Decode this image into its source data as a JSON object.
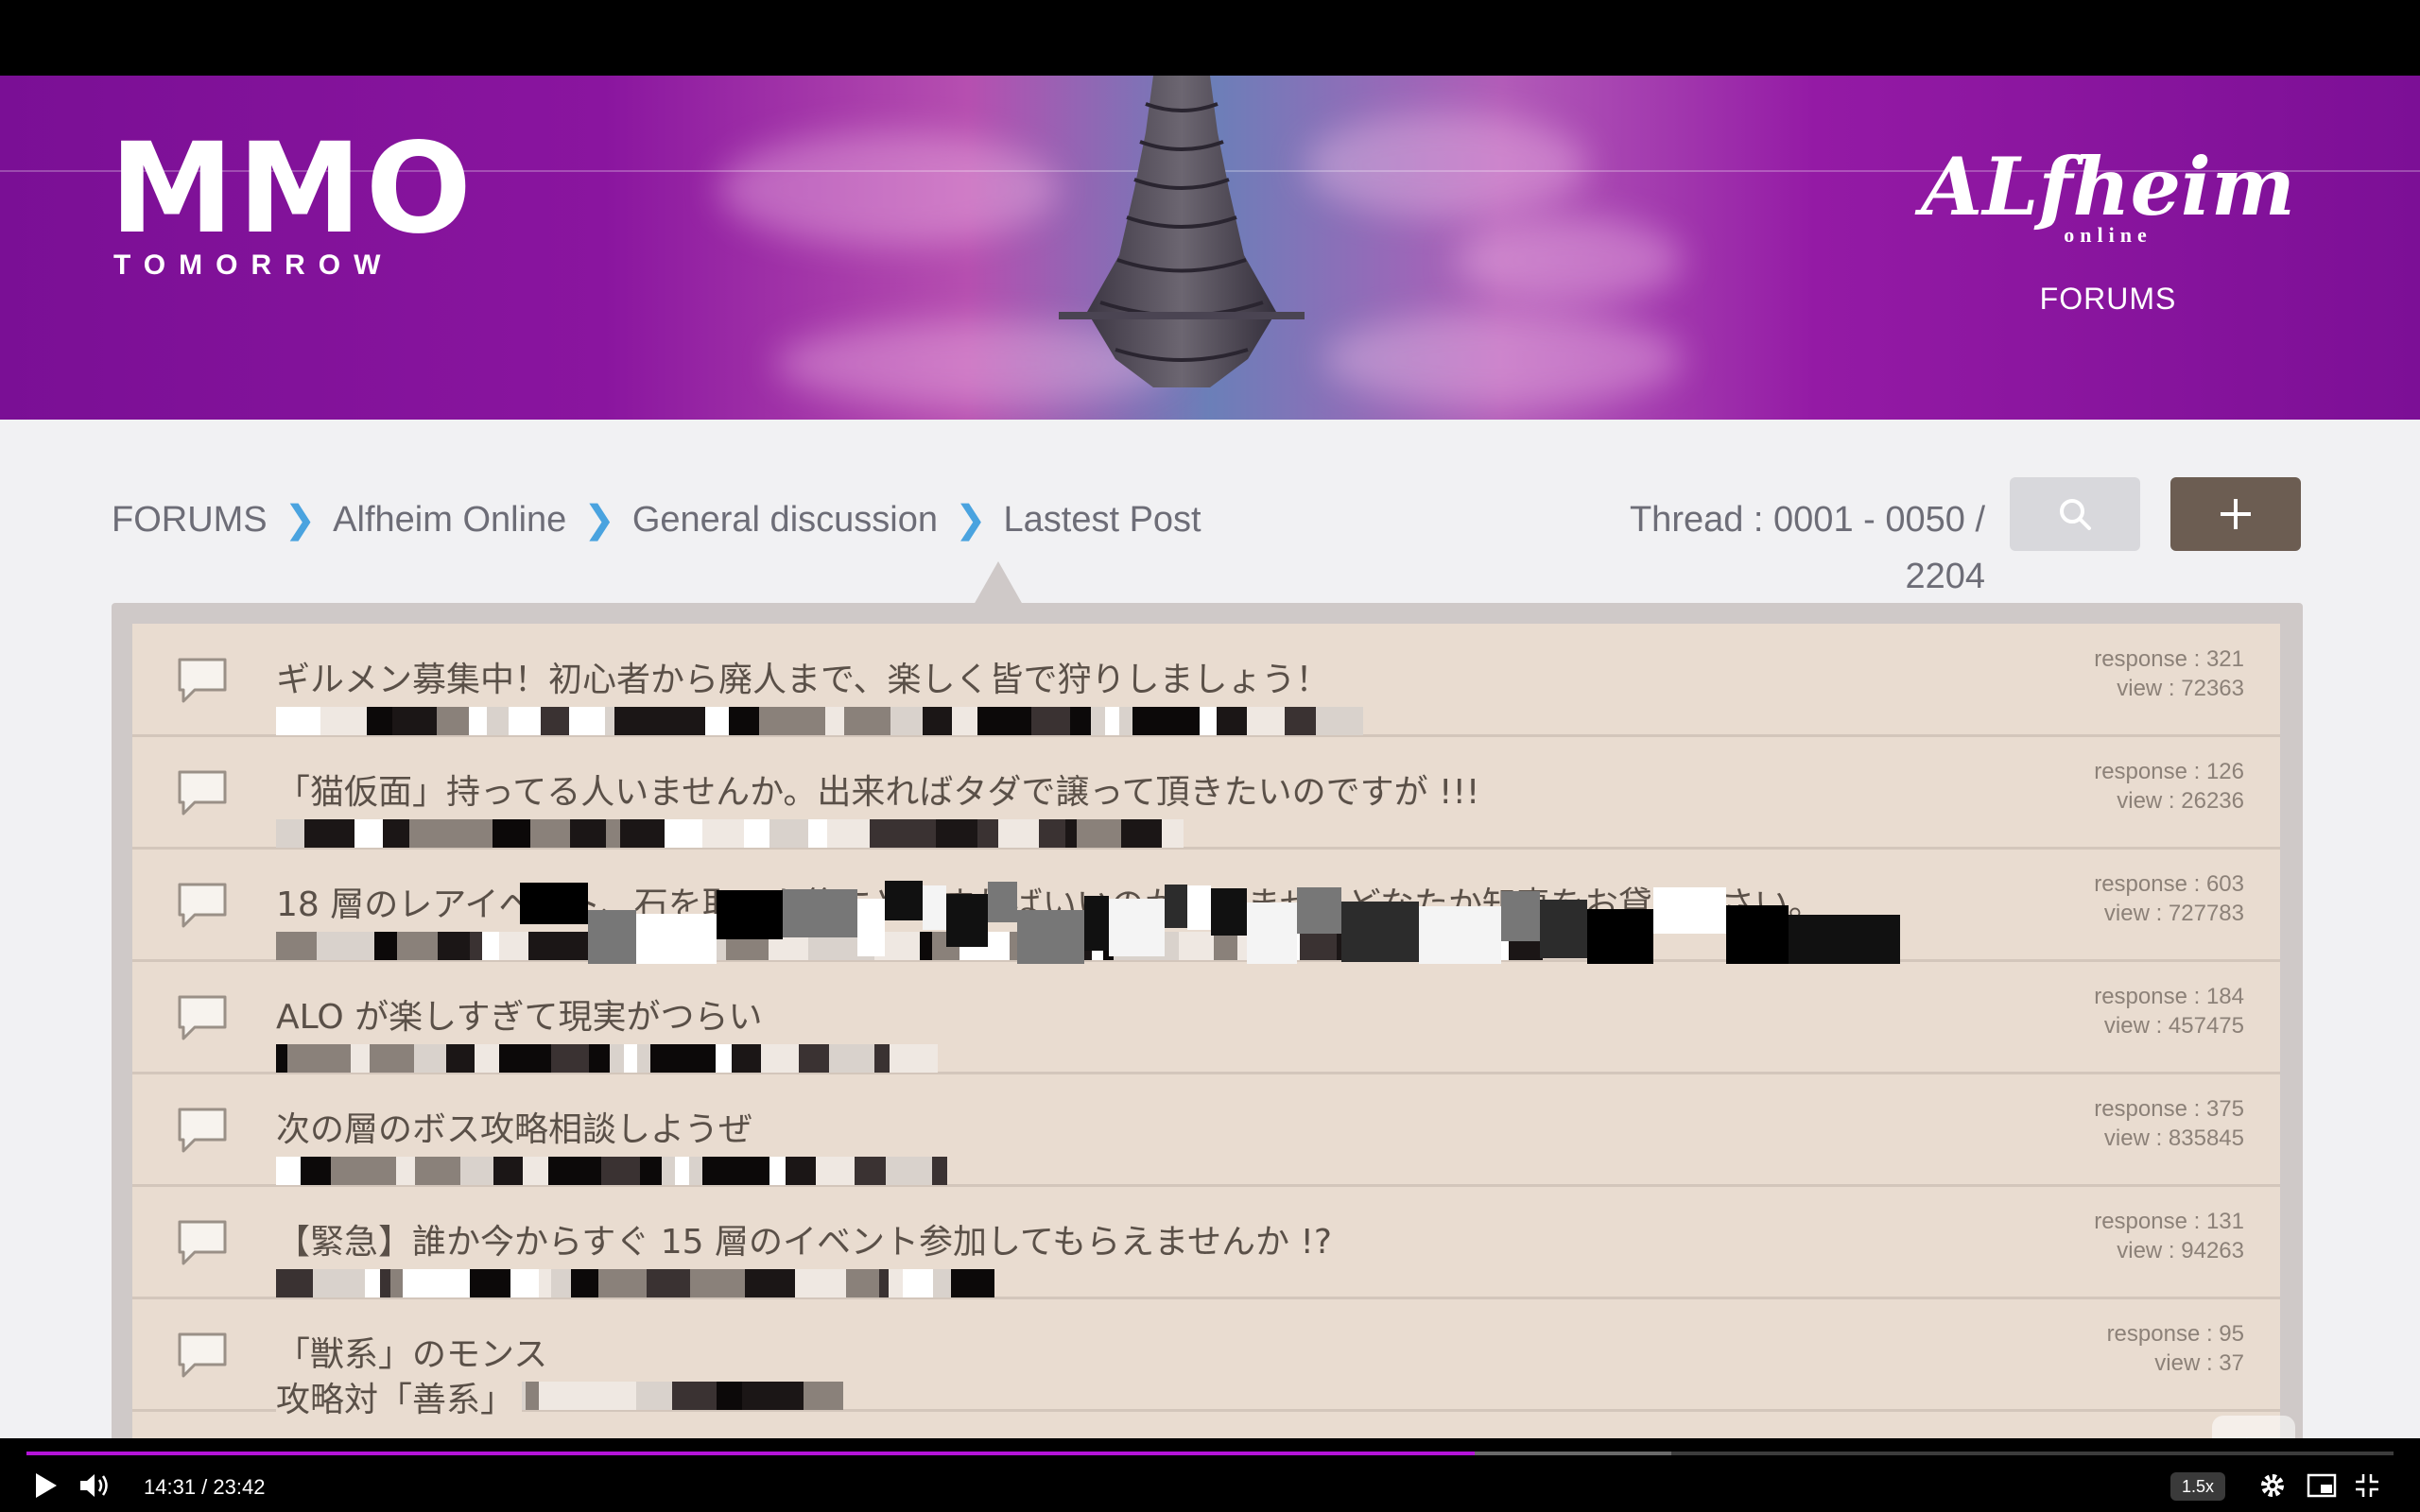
{
  "banner": {
    "logo_left_main": "MMO",
    "logo_left_sub": "TOMORROW",
    "logo_right_main": "ALfheim",
    "logo_right_sub": "online",
    "logo_right_caption": "FORUMS"
  },
  "breadcrumb": [
    {
      "label": "FORUMS"
    },
    {
      "label": "Alfheim Online"
    },
    {
      "label": "General discussion"
    },
    {
      "label": "Lastest Post"
    }
  ],
  "thread_count": "Thread : 0001 - 0050 / 2204",
  "icons": {
    "search": "search-icon",
    "new_thread": "plus-icon",
    "thread": "speech-bubble-icon"
  },
  "colors": {
    "banner_purple": "#8a159f",
    "accent_blue": "#4aa3df",
    "new_button": "#6c5d52",
    "progress": "#b414d8"
  },
  "threads": [
    {
      "title": "ギルメン募集中！初心者から廃人まで、楽しく皆で狩りしましょう！",
      "response": "response : 321",
      "view": "view : 72363"
    },
    {
      "title": "「猫仮面」持ってる人いませんか。出来ればタダで譲って頂きたいのですが !!!",
      "response": "response : 126",
      "view": "view : 26236"
    },
    {
      "title": "18 層のレアイベント、石を取った後にどうすればいいのか判りませんどなたか知恵をお貸し下さい。",
      "response": "response : 603",
      "view": "view : 727783"
    },
    {
      "title": "ALO が楽しすぎて現実がつらい",
      "response": "response : 184",
      "view": "view : 457475"
    },
    {
      "title": "次の層のボス攻略相談しようぜ",
      "response": "response : 375",
      "view": "view : 835845"
    },
    {
      "title": "【緊急】誰か今からすぐ 15 層のイベント参加してもらえませんか !?",
      "response": "response : 131",
      "view": "view : 94263"
    },
    {
      "title": "「獣系」のモンス",
      "subtitle": "攻略対「善系」",
      "response": "response : 95",
      "view": "view : 37"
    }
  ],
  "player": {
    "time": "14:31 / 23:42",
    "speed": "1.5x",
    "played_fraction": 0.612,
    "buffered_fraction": 0.695
  }
}
